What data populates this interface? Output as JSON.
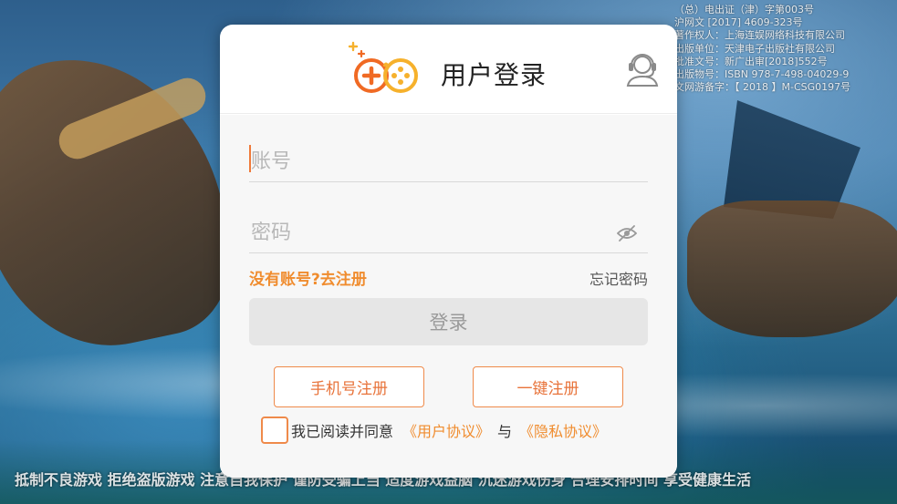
{
  "license_lines": [
    "（总）电出证（津）字第003号",
    "沪网文 [2017] 4609-323号",
    "著作权人：上海连娱网络科技有限公司",
    "出版单位：天津电子出版社有限公司",
    "批准文号：新广出审[2018]552号",
    "出版物号：ISBN 978-7-498-04029-9",
    "文网游备字：【 2018 】M-CSG0197号"
  ],
  "health_notice": "抵制不良游戏  拒绝盗版游戏  注意自我保护  谨防受骗上当  适度游戏益脑  沉迷游戏伤身  合理安排时间  享受健康生活",
  "dialog": {
    "title": "用户登录",
    "account_placeholder": "账号",
    "password_placeholder": "密码",
    "register_link": "没有账号?去注册",
    "forgot_link": "忘记密码",
    "login_button": "登录",
    "phone_register_button": "手机号注册",
    "onekey_register_button": "一键注册",
    "agree_text": "我已阅读并同意",
    "user_agreement": "《用户协议》",
    "and_text": "与",
    "privacy_policy": "《隐私协议》"
  },
  "colors": {
    "accent": "#f08c2e",
    "logo_orange": "#f06a24",
    "logo_yellow": "#f6b12c",
    "button_disabled_bg": "#e6e6e6"
  },
  "icons": {
    "logo": "gamepad-plus-logo",
    "support": "customer-service-headset-icon",
    "password_visibility": "eye-icon"
  }
}
